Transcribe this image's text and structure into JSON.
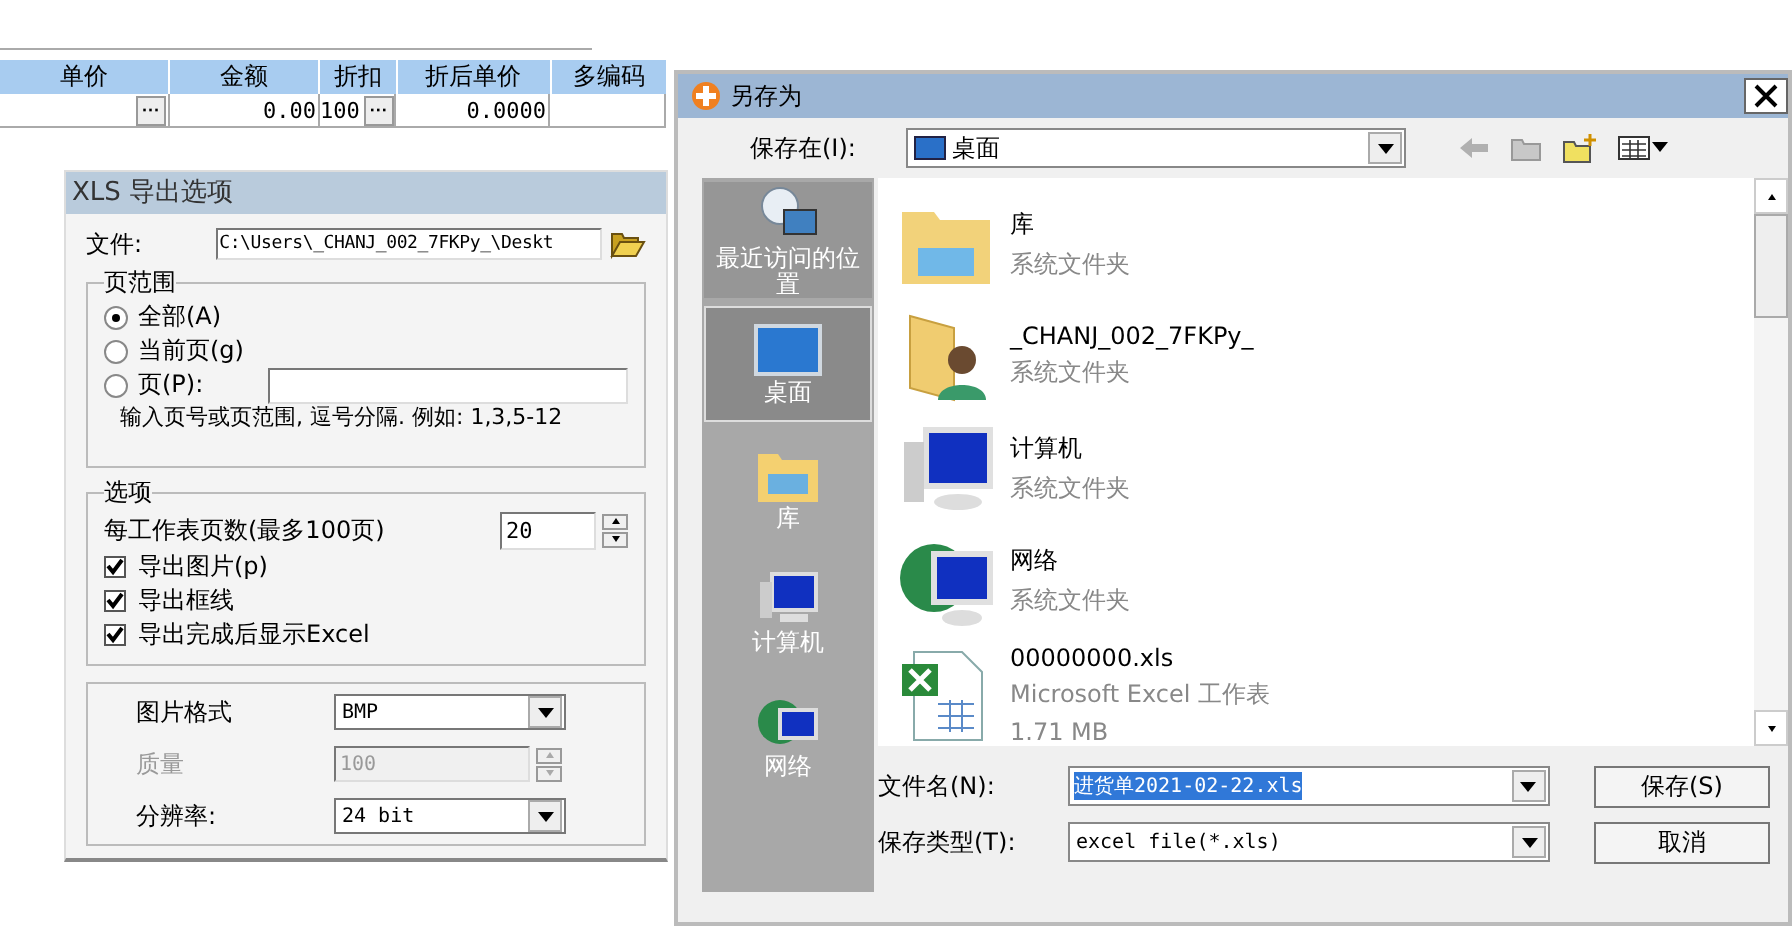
{
  "grid": {
    "columns": [
      "单价",
      "金额",
      "折扣",
      "折后单价",
      "多编码"
    ],
    "row": [
      {
        "button": "···"
      },
      {
        "value": "0.00"
      },
      {
        "value": "100",
        "button": "···"
      },
      {
        "value": "0.0000"
      }
    ]
  },
  "xls_dialog": {
    "title": "XLS 导出选项",
    "file_label": "文件:",
    "file_value": "C:\\Users\\_CHANJ_002_7FKPy_\\Deskt",
    "page_range": {
      "legend": "页范围",
      "options": [
        {
          "label": "全部(A)",
          "selected": true,
          "input": false
        },
        {
          "label": "当前页(g)",
          "selected": false,
          "input": false
        },
        {
          "label": "页(P):",
          "selected": false,
          "input": true
        }
      ],
      "hint": "输入页号或页范围, 逗号分隔. 例如: 1,3,5-12"
    },
    "options": {
      "legend": "选项",
      "pages_label": "每工作表页数(最多100页)",
      "pages_value": "20",
      "checkboxes": [
        {
          "label": "导出图片(p)",
          "checked": true
        },
        {
          "label": "导出框线",
          "checked": true
        },
        {
          "label": "导出完成后显示Excel",
          "checked": true
        }
      ]
    },
    "settings": [
      {
        "kind": "select",
        "label": "图片格式",
        "value": "BMP",
        "disabled": false
      },
      {
        "kind": "spin",
        "label": "质量",
        "value": "100",
        "disabled": true
      },
      {
        "kind": "select",
        "label": "分辨率:",
        "value": "24 bit",
        "disabled": false
      }
    ]
  },
  "save_dialog": {
    "title": "另存为",
    "save_in_label": "保存在(I):",
    "location": "桌面",
    "places": [
      {
        "kind": "recent",
        "label": "最近访问的位置",
        "selected": false
      },
      {
        "kind": "desktop",
        "label": "桌面",
        "selected": true
      },
      {
        "kind": "library",
        "label": "库",
        "selected": false
      },
      {
        "kind": "computer",
        "label": "计算机",
        "selected": false
      },
      {
        "kind": "network",
        "label": "网络",
        "selected": false
      }
    ],
    "files": [
      {
        "kind": "library",
        "name": "库",
        "type": "系统文件夹"
      },
      {
        "kind": "user",
        "name": "_CHANJ_002_7FKPy_",
        "type": "系统文件夹"
      },
      {
        "kind": "computer",
        "name": "计算机",
        "type": "系统文件夹"
      },
      {
        "kind": "network",
        "name": "网络",
        "type": "系统文件夹"
      },
      {
        "kind": "excel",
        "name": "00000000.xls",
        "type": "Microsoft Excel 工作表",
        "size": "1.71 MB"
      }
    ],
    "filename_label": "文件名(N):",
    "filename": "进货单2021-02-22.xls",
    "filetype_label": "保存类型(T):",
    "filetype": "excel file(*.xls)",
    "buttons": [
      "保存(S)",
      "取消"
    ]
  }
}
